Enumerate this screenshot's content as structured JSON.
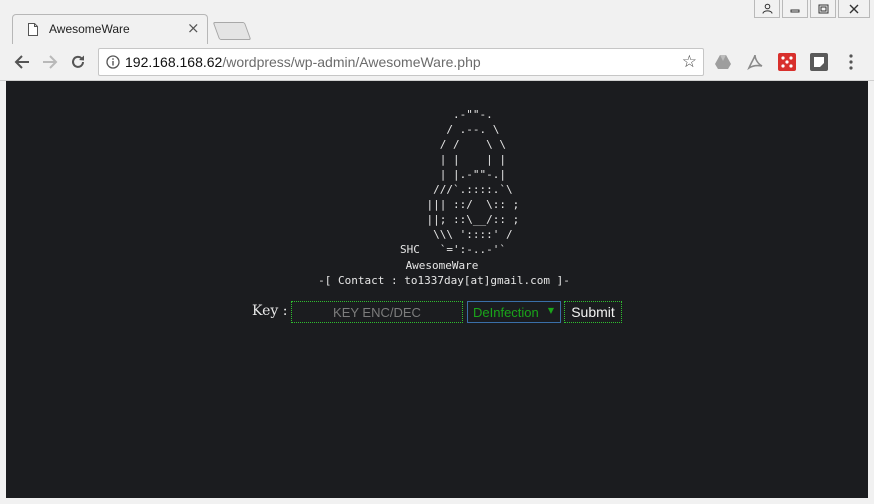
{
  "browser": {
    "tab_title": "AwesomeWare",
    "url_host": "192.168.168.62",
    "url_path": "/wordpress/wp-admin/AwesomeWare.php"
  },
  "page": {
    "ascii_art": "        .-\"\"-.\n       / .--. \\\n      / /    \\ \\\n      | |    | |\n      | |.-\"\"-.|\n     ///`.::::.`\\\n    ||| ::/  \\:: ;\n    ||; ::\\__/:: ;\n     \\\\\\ '::::' /\nSHC   `=':-..-'`",
    "brand": "AwesomeWare",
    "contact": "-[ Contact : to1337day[at]gmail.com ]-",
    "key_label": "Key :",
    "key_placeholder": "KEY ENC/DEC",
    "mode_selected": "DeInfection",
    "submit_label": "Submit"
  },
  "colors": {
    "page_bg": "#1b1c1f",
    "accent_green": "#1aa51a",
    "select_border": "#3a6fa8"
  },
  "icons": {
    "tab": "page-icon",
    "close": "close-icon",
    "back": "back-arrow-icon",
    "forward": "forward-arrow-icon",
    "reload": "reload-icon",
    "info": "info-icon",
    "bookmark": "star-icon",
    "menu": "more-vertical-icon"
  }
}
